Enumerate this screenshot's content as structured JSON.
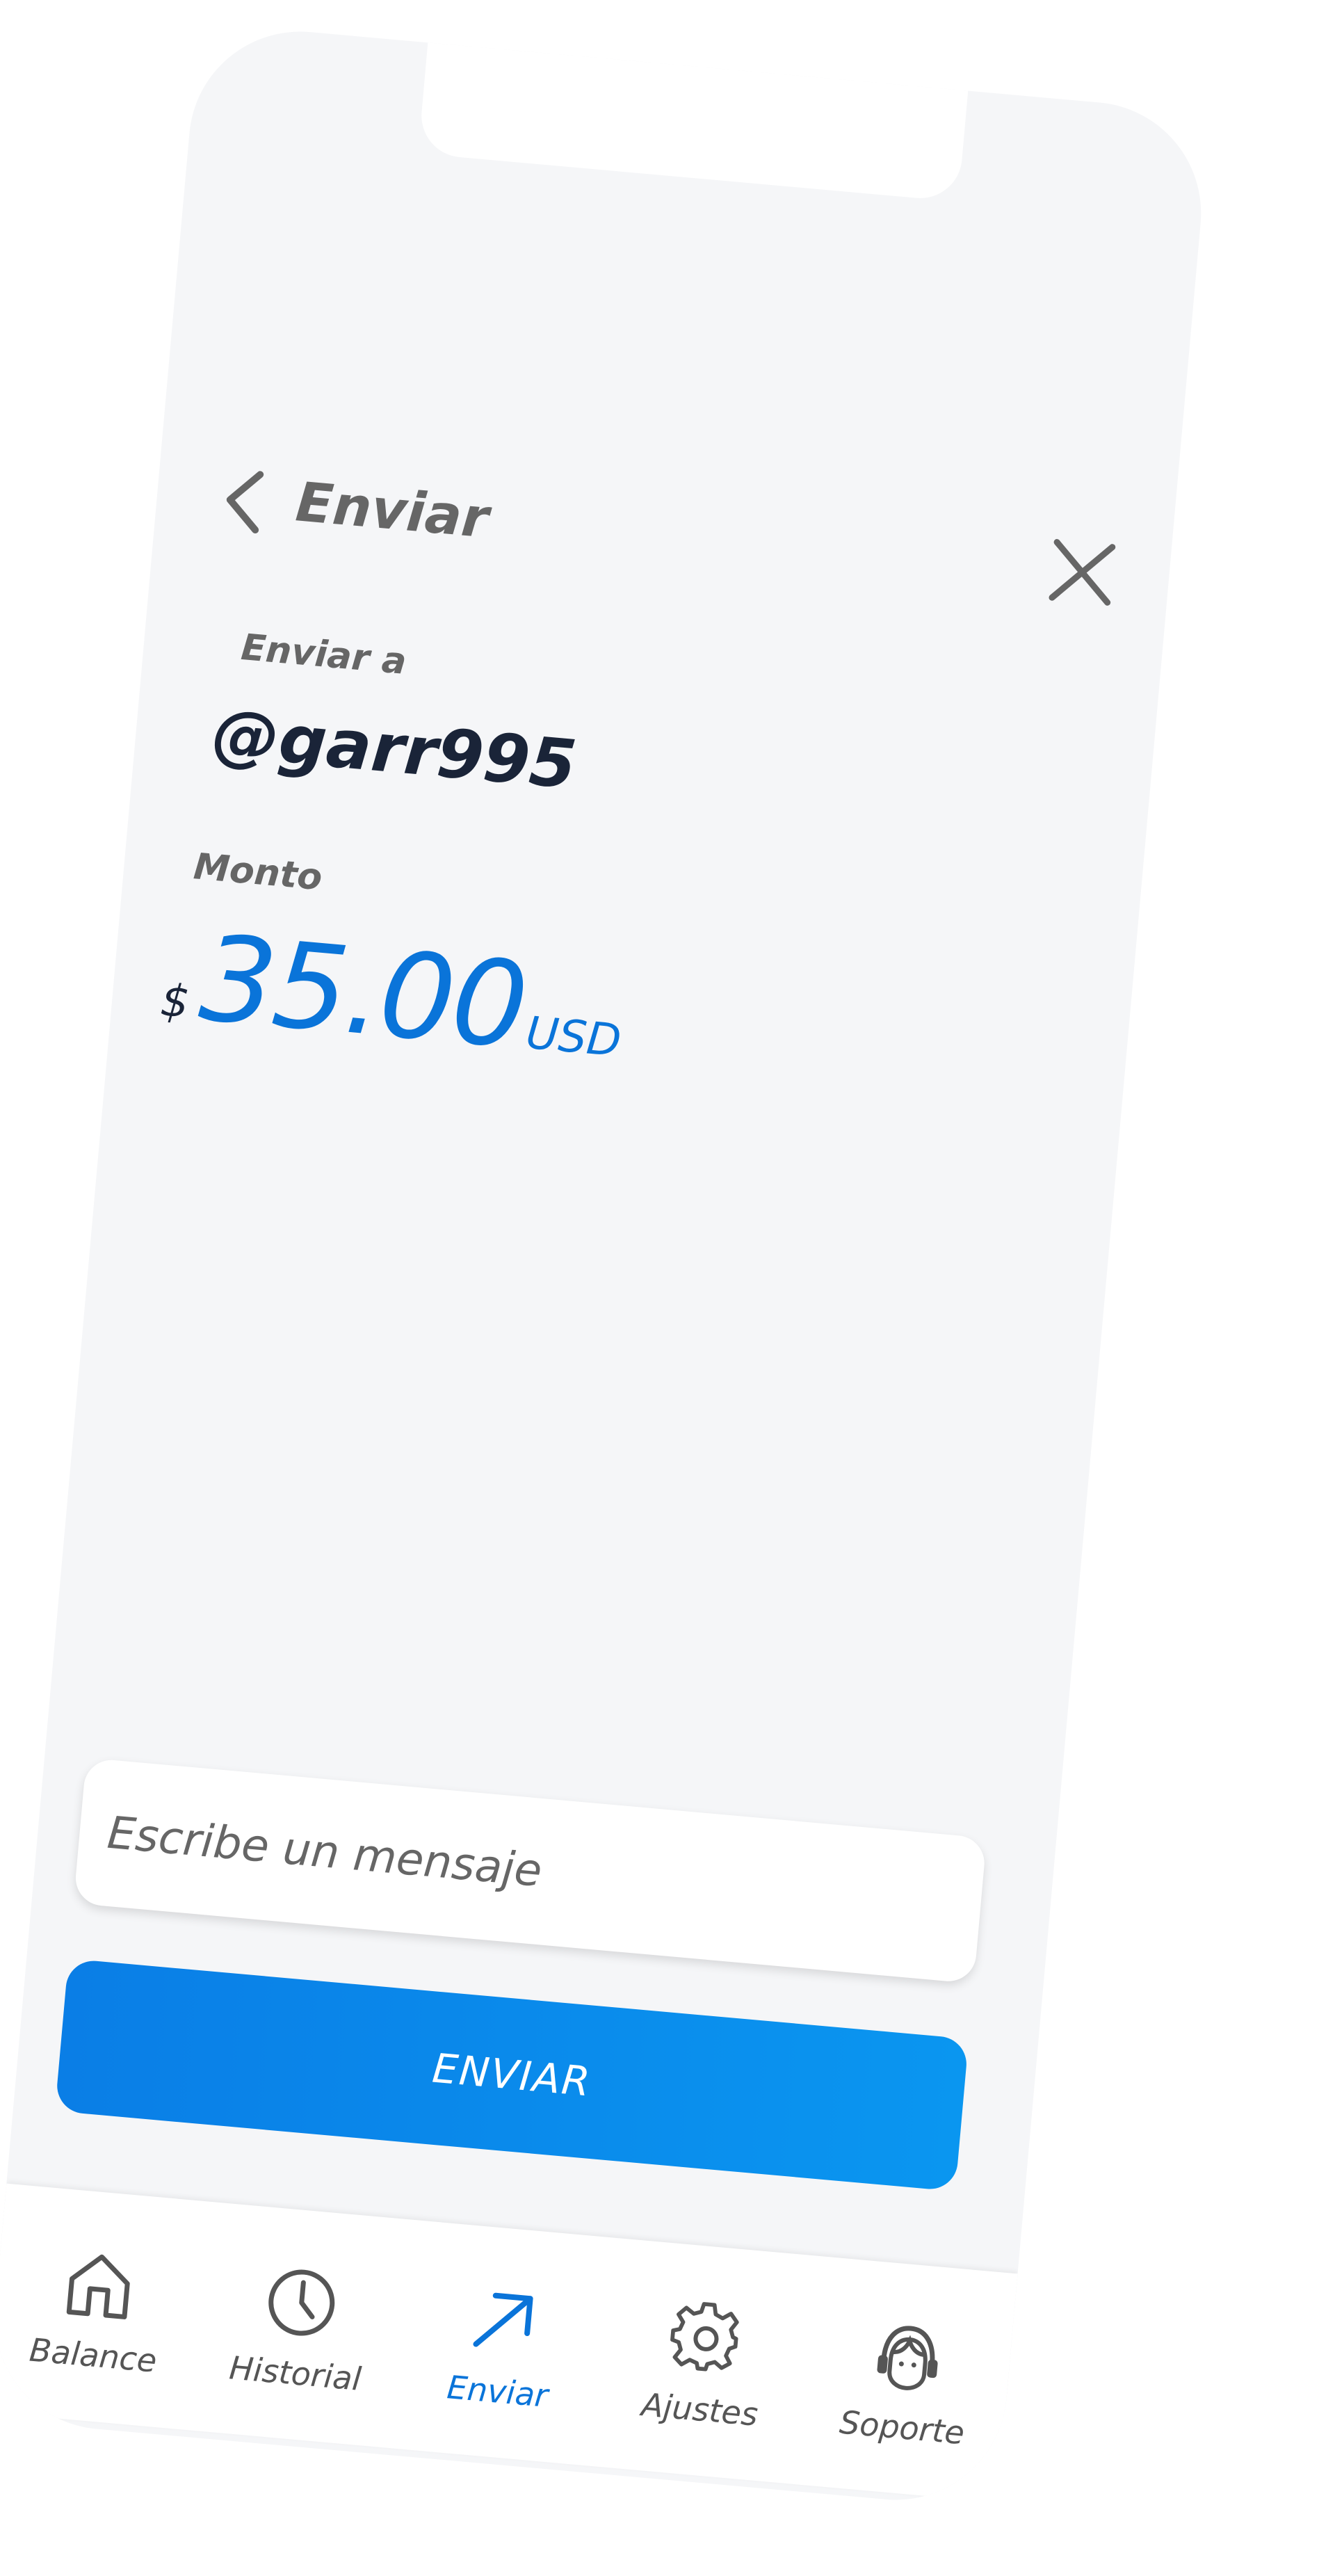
{
  "header": {
    "title": "Enviar"
  },
  "recipient": {
    "label": "Enviar a",
    "handle": "@garr995"
  },
  "amount": {
    "label": "Monto",
    "currency_symbol": "$",
    "value": "35.00",
    "currency_code": "USD"
  },
  "message": {
    "placeholder": "Escribe un mensaje",
    "value": ""
  },
  "send_button": {
    "label": "ENVIAR"
  },
  "tabbar": {
    "items": [
      {
        "label": "Balance",
        "icon": "home-icon",
        "active": false
      },
      {
        "label": "Historial",
        "icon": "clock-icon",
        "active": false
      },
      {
        "label": "Enviar",
        "icon": "arrow-up-right-icon",
        "active": true
      },
      {
        "label": "Ajustes",
        "icon": "gear-icon",
        "active": false
      },
      {
        "label": "Soporte",
        "icon": "support-agent-icon",
        "active": false
      }
    ]
  },
  "colors": {
    "accent": "#0a74d9",
    "background": "#f5f6f8",
    "text_dark": "#1a2438",
    "text_muted": "#666666"
  }
}
